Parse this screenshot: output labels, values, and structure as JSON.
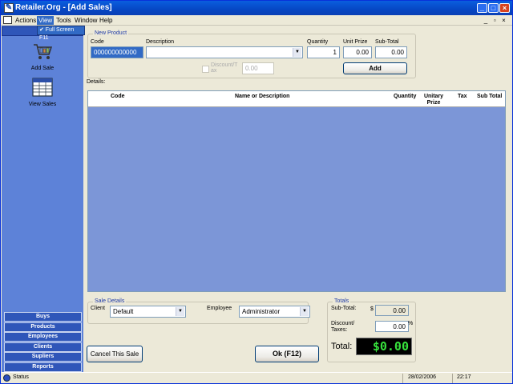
{
  "window": {
    "title": "Retailer.Org - [Add Sales]",
    "minimize_label": "_",
    "maximize_label": "□",
    "close_label": "×"
  },
  "menu": {
    "items": [
      "Actions",
      "View",
      "Tools",
      "Window",
      "Help"
    ],
    "active": "View",
    "dropdown_item": "✔ Full Screen   F11",
    "mdi_buttons": [
      "_",
      "▫",
      "×"
    ]
  },
  "sidebar": {
    "top_items": [
      {
        "label": "Add Sale",
        "icon": "cart-icon"
      },
      {
        "label": "View Sales",
        "icon": "table-icon"
      }
    ],
    "bottom_items": [
      "Buys",
      "Products",
      "Employees",
      "Clients",
      "Supliers",
      "Reports"
    ]
  },
  "new_product": {
    "title": "New Product",
    "code_label": "Code",
    "code_value": "000000000000",
    "description_label": "Description",
    "description_value": "",
    "discount_label": "Discount/T ax",
    "discount_value": "0.00",
    "quantity_label": "Quantity",
    "quantity_value": "1",
    "unit_prize_label": "Unit Prize",
    "unit_prize_value": "0.00",
    "subtotal_label": "Sub-Total",
    "subtotal_value": "0.00",
    "add_button": "Add"
  },
  "details": {
    "label": "Details:",
    "columns": [
      "Code",
      "Name or Description",
      "Quantity",
      "Unitary Prize",
      "Tax",
      "Sub Total"
    ]
  },
  "sale_details": {
    "title": "Sale Details",
    "client_label": "Client",
    "client_value": "Default",
    "employee_label": "Employee",
    "employee_value": "Administrator"
  },
  "totals": {
    "title": "Totals",
    "subtotal_label": "Sub-Total:",
    "currency": "$",
    "subtotal_value": "0.00",
    "discount_label": "Discount/ Taxes:",
    "discount_value": "0.00",
    "percent": "%",
    "total_label": "Total:",
    "total_value": "$0.00"
  },
  "actions": {
    "cancel_button": "Cancel This Sale",
    "ok_button": "Ok (F12)"
  },
  "status": {
    "text": "Status",
    "date": "28/02/2006",
    "time": "22:17"
  },
  "colors": {
    "sidebar_bg": "#5d82d8",
    "grid_bg": "#7c96d7",
    "total_text": "#37e23c",
    "title_bar": "#0647c4"
  }
}
